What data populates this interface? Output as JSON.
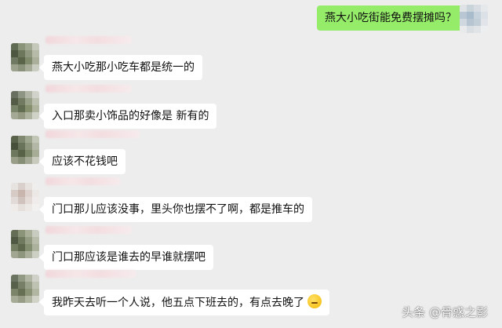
{
  "conversation": {
    "outgoing": {
      "text": "燕大小吃街能免费摆摊吗？"
    },
    "incoming": [
      {
        "text": "燕大小吃那小吃车都是统一的"
      },
      {
        "text": "入口那卖小饰品的好像是 新有的"
      },
      {
        "text": "应该不花钱吧"
      },
      {
        "text": "门口那儿应该没事，里头你也摆不了啊，都是推车的"
      },
      {
        "text": "门口那应该是谁去的早谁就摆吧"
      },
      {
        "text": "我昨天去听一个人说，他五点下班去的，有点去晚了",
        "emoji": "thinking-emoji"
      }
    ]
  },
  "watermark": {
    "text": "头条 @骨惑之影"
  },
  "colors": {
    "background": "#ededed",
    "bubble_in": "#ffffff",
    "bubble_out": "#95ec69",
    "name_blur": "#f3dde0"
  }
}
